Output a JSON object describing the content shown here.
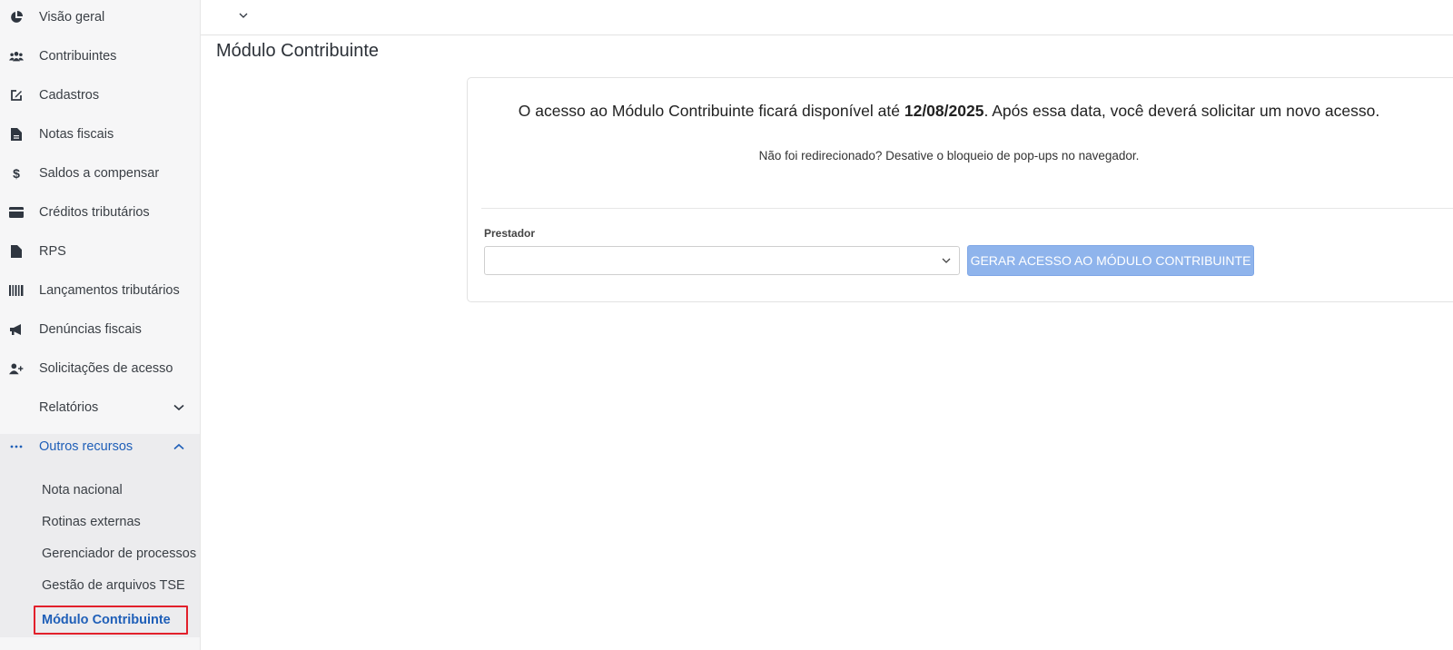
{
  "sidebar": {
    "items": [
      {
        "label": "Visão geral",
        "icon": "pie-chart-icon"
      },
      {
        "label": "Contribuintes",
        "icon": "users-icon"
      },
      {
        "label": "Cadastros",
        "icon": "edit-icon"
      },
      {
        "label": "Notas fiscais",
        "icon": "file-icon"
      },
      {
        "label": "Saldos a compensar",
        "icon": "dollar-icon"
      },
      {
        "label": "Créditos tributários",
        "icon": "credit-card-icon"
      },
      {
        "label": "RPS",
        "icon": "file-icon"
      },
      {
        "label": "Lançamentos tributários",
        "icon": "barcode-icon"
      },
      {
        "label": "Denúncias fiscais",
        "icon": "megaphone-icon"
      },
      {
        "label": "Solicitações de acesso",
        "icon": "user-plus-icon"
      },
      {
        "label": "Relatórios",
        "icon": ""
      },
      {
        "label": "Outros recursos",
        "icon": "ellipsis-icon"
      }
    ],
    "subitems": [
      {
        "label": "Nota nacional"
      },
      {
        "label": "Rotinas externas"
      },
      {
        "label": "Gerenciador de processos"
      },
      {
        "label": "Gestão de arquivos TSE"
      },
      {
        "label": "Módulo Contribuinte"
      }
    ],
    "active_color": "#1f5fb8"
  },
  "page": {
    "title": "Módulo Contribuinte"
  },
  "notice": {
    "text_before": "O acesso ao Módulo Contribuinte ficará disponível até ",
    "date": "12/08/2025",
    "text_after": ". Após essa data, você deverá solicitar um novo acesso.",
    "sub": "Não foi redirecionado? Desative o bloqueio de pop-ups no navegador."
  },
  "form": {
    "prestador_label": "Prestador",
    "prestador_value": "",
    "button_label": "GERAR ACESSO AO MÓDULO CONTRIBUINTE",
    "button_color": "#8fb4ec"
  }
}
